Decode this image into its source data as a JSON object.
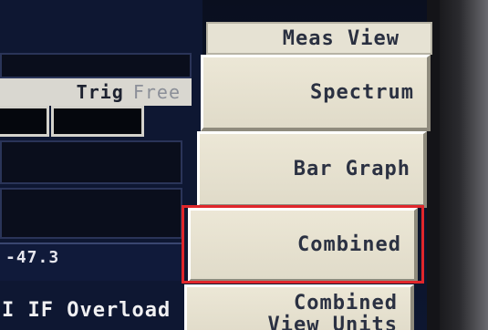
{
  "menu": {
    "title": "Meas View",
    "softkeys": [
      {
        "id": "spectrum",
        "lines": [
          "Spectrum"
        ]
      },
      {
        "id": "bar-graph",
        "lines": [
          "Bar Graph"
        ]
      },
      {
        "id": "combined",
        "lines": [
          "Combined"
        ]
      },
      {
        "id": "combined-view-units",
        "lines": [
          "Combined",
          "View Units"
        ]
      }
    ],
    "highlighted": "Combined",
    "highlight_color": "#e0262b"
  },
  "measurement": {
    "trig_label": "Trig",
    "trig_value": "Free",
    "readout_value": "-47.3",
    "status_message": "I IF Overload"
  }
}
